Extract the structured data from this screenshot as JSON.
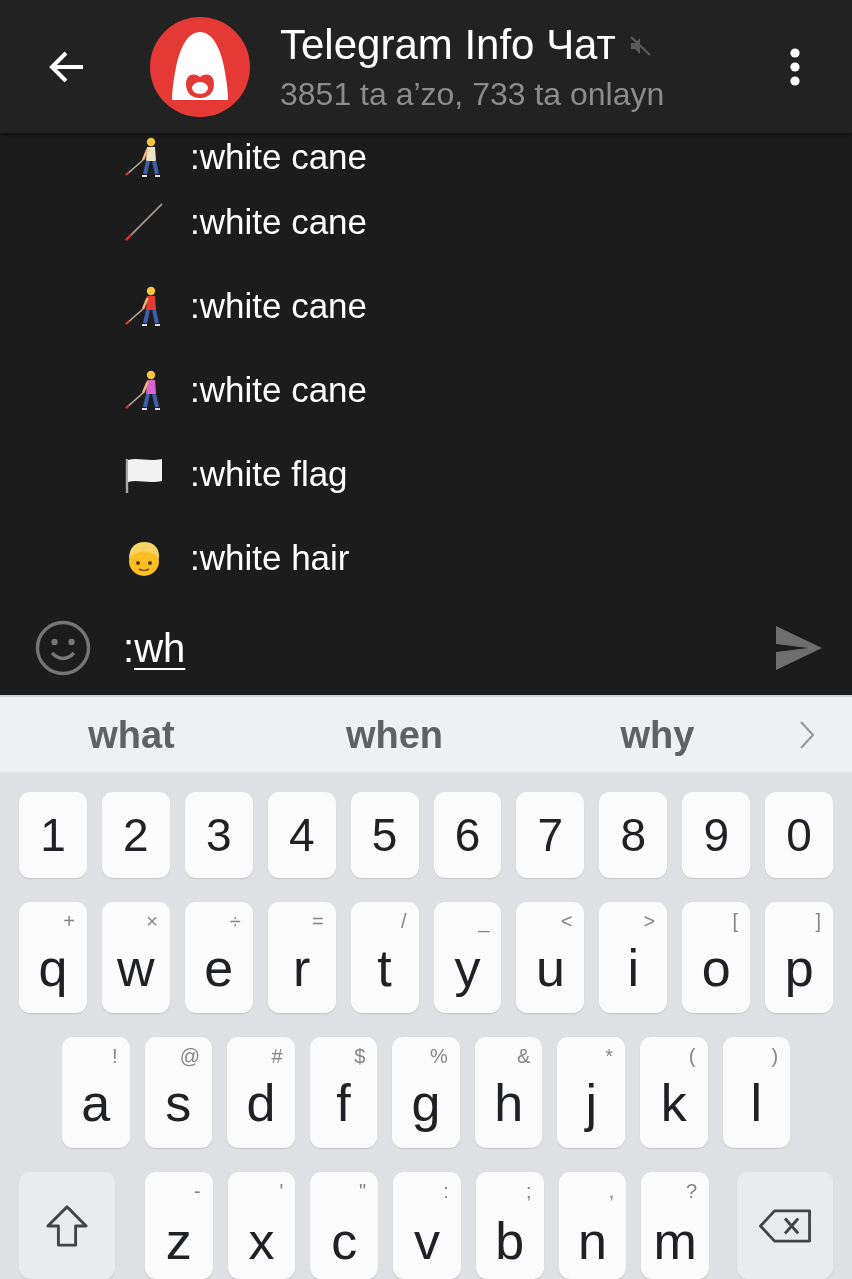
{
  "header": {
    "title": "Telegram Info Чат",
    "muted": true,
    "subtitle": "3851 ta a’zo, 733 ta onlayn"
  },
  "emoji_suggestions": [
    {
      "label": ":white cane"
    },
    {
      "label": ":white cane"
    },
    {
      "label": ":white cane"
    },
    {
      "label": ":white cane"
    },
    {
      "label": ":white flag"
    },
    {
      "label": ":white hair"
    }
  ],
  "composer": {
    "text": ":",
    "composing_text": "wh"
  },
  "keyboard": {
    "suggestions": [
      "what",
      "when",
      "why"
    ],
    "rows": [
      [
        {
          "kind": "char",
          "label": "1"
        },
        {
          "kind": "char",
          "label": "2"
        },
        {
          "kind": "char",
          "label": "3"
        },
        {
          "kind": "char",
          "label": "4"
        },
        {
          "kind": "char",
          "label": "5"
        },
        {
          "kind": "char",
          "label": "6"
        },
        {
          "kind": "char",
          "label": "7"
        },
        {
          "kind": "char",
          "label": "8"
        },
        {
          "kind": "char",
          "label": "9"
        },
        {
          "kind": "char",
          "label": "0"
        }
      ],
      [
        {
          "kind": "char",
          "label": "q",
          "hint": "+"
        },
        {
          "kind": "char",
          "label": "w",
          "hint": "×"
        },
        {
          "kind": "char",
          "label": "e",
          "hint": "÷"
        },
        {
          "kind": "char",
          "label": "r",
          "hint": "="
        },
        {
          "kind": "char",
          "label": "t",
          "hint": "/"
        },
        {
          "kind": "char",
          "label": "y",
          "hint": "_"
        },
        {
          "kind": "char",
          "label": "u",
          "hint": "<"
        },
        {
          "kind": "char",
          "label": "i",
          "hint": ">"
        },
        {
          "kind": "char",
          "label": "o",
          "hint": "["
        },
        {
          "kind": "char",
          "label": "p",
          "hint": "]"
        }
      ],
      [
        {
          "kind": "char",
          "label": "a",
          "hint": "!"
        },
        {
          "kind": "char",
          "label": "s",
          "hint": "@"
        },
        {
          "kind": "char",
          "label": "d",
          "hint": "#"
        },
        {
          "kind": "char",
          "label": "f",
          "hint": "$"
        },
        {
          "kind": "char",
          "label": "g",
          "hint": "%"
        },
        {
          "kind": "char",
          "label": "h",
          "hint": "&"
        },
        {
          "kind": "char",
          "label": "j",
          "hint": "*"
        },
        {
          "kind": "char",
          "label": "k",
          "hint": "("
        },
        {
          "kind": "char",
          "label": "l",
          "hint": ")"
        }
      ],
      [
        {
          "kind": "shift"
        },
        {
          "kind": "char",
          "label": "z",
          "hint": "-"
        },
        {
          "kind": "char",
          "label": "x",
          "hint": "'"
        },
        {
          "kind": "char",
          "label": "c",
          "hint": "\""
        },
        {
          "kind": "char",
          "label": "v",
          "hint": ":"
        },
        {
          "kind": "char",
          "label": "b",
          "hint": ";"
        },
        {
          "kind": "char",
          "label": "n",
          "hint": ","
        },
        {
          "kind": "char",
          "label": "m",
          "hint": "?"
        },
        {
          "kind": "backspace"
        }
      ]
    ]
  }
}
